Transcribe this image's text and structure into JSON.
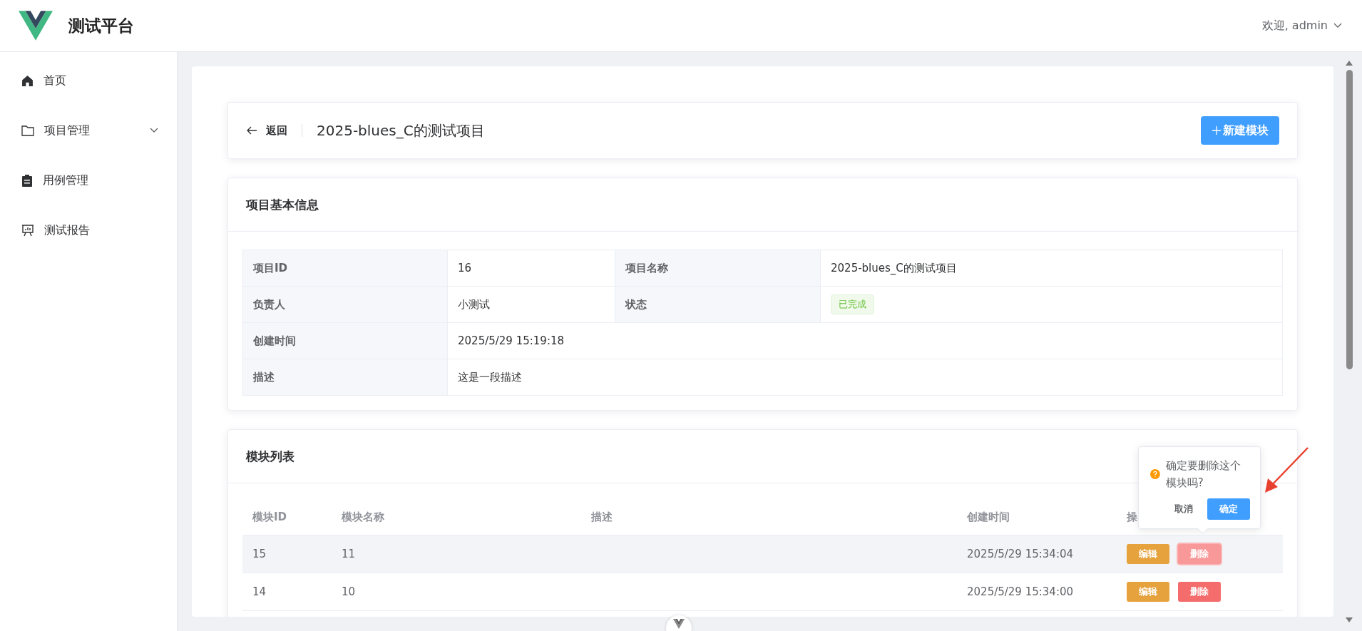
{
  "app": {
    "title": "测试平台",
    "user_menu": "欢迎, admin"
  },
  "sidebar": {
    "items": [
      {
        "kind": "home",
        "label": "首页",
        "selected": false,
        "has_submenu": false
      },
      {
        "kind": "folder",
        "label": "项目管理",
        "selected": false,
        "has_submenu": true
      },
      {
        "kind": "clipboard",
        "label": "用例管理",
        "selected": false,
        "has_submenu": false
      },
      {
        "kind": "board",
        "label": "测试报告",
        "selected": false,
        "has_submenu": false
      }
    ]
  },
  "page_header": {
    "back_label": "返回",
    "title": "2025-blues_C的测试项目",
    "primary_button": "新建模块"
  },
  "info_card": {
    "title": "项目基本信息",
    "rows": [
      [
        {
          "label": "项目ID",
          "value": "16",
          "kind": "text"
        },
        {
          "label": "项目名称",
          "value": "2025-blues_C的测试项目",
          "kind": "text"
        }
      ],
      [
        {
          "label": "负责人",
          "value": "小测试",
          "kind": "text"
        },
        {
          "label": "状态",
          "value": "已完成",
          "kind": "tag"
        }
      ],
      [
        {
          "label": "创建时间",
          "value": "2025/5/29 15:19:18",
          "kind": "text"
        }
      ],
      [
        {
          "label": "描述",
          "value": "这是一段描述",
          "kind": "text"
        }
      ]
    ]
  },
  "modules_card": {
    "title": "模块列表",
    "columns": [
      "模块ID",
      "模块名称",
      "描述",
      "创建时间",
      "操"
    ],
    "rows": [
      {
        "id": "15",
        "name": "11",
        "created": "2025/5/29 15:34:04",
        "hovered": true,
        "actions": [
          {
            "kind": "edit",
            "label": "编辑",
            "active": false
          },
          {
            "kind": "delete",
            "label": "删除",
            "active": true
          }
        ]
      },
      {
        "id": "14",
        "name": "10",
        "created": "2025/5/29 15:34:00",
        "hovered": false,
        "actions": [
          {
            "kind": "edit",
            "label": "编辑",
            "active": false
          },
          {
            "kind": "delete",
            "label": "删除",
            "active": false
          }
        ]
      }
    ]
  },
  "popconfirm": {
    "message": "确定要删除这个模块吗?",
    "cancel": "取消",
    "confirm": "确定"
  }
}
